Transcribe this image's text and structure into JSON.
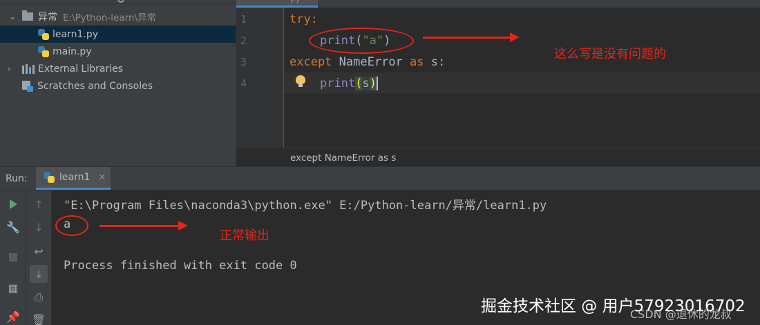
{
  "project_tree": {
    "items": [
      {
        "label": "异常",
        "path": "E:\\Python-learn\\异常",
        "type": "folder",
        "expanded": true
      },
      {
        "label": "learn1.py",
        "type": "python-file",
        "selected": true
      },
      {
        "label": "main.py",
        "type": "python-file"
      },
      {
        "label": "External Libraries",
        "type": "library",
        "expanded": false
      },
      {
        "label": "Scratches and Consoles",
        "type": "scratch"
      }
    ]
  },
  "editor": {
    "active_tab": "py",
    "line_numbers": [
      "1",
      "2",
      "3",
      "4"
    ],
    "lines": {
      "l1_kw": "try",
      "l1_colon": ":",
      "l2_fn": "print",
      "l2_open": "(",
      "l2_str": "\"a\"",
      "l2_close": ")",
      "l3_kw": "except",
      "l3_cls": "NameError",
      "l3_as": "as",
      "l3_var": "s:",
      "l4_fn": "print",
      "l4_open": "(",
      "l4_var": "s",
      "l4_close": ")"
    },
    "breadcrumb": "except NameError as s"
  },
  "run_panel": {
    "label": "Run:",
    "tab_label": "learn1",
    "console_lines": [
      "\"E:\\Program Files\\naconda3\\python.exe\" E:/Python-learn/异常/learn1.py",
      "a",
      "",
      "Process finished with exit code 0"
    ]
  },
  "annotations": {
    "note_editor": "这么写是没有问题的",
    "note_console": "正常输出"
  },
  "watermarks": {
    "main": "掘金技术社区 @ 用户57923016702",
    "csdn": "CSDN @退休的龙叔"
  },
  "colors": {
    "annotation": "#e0261b",
    "keyword": "#cc7832",
    "builtin": "#8888c6",
    "string": "#6a8759",
    "accent": "#4a88c7"
  }
}
